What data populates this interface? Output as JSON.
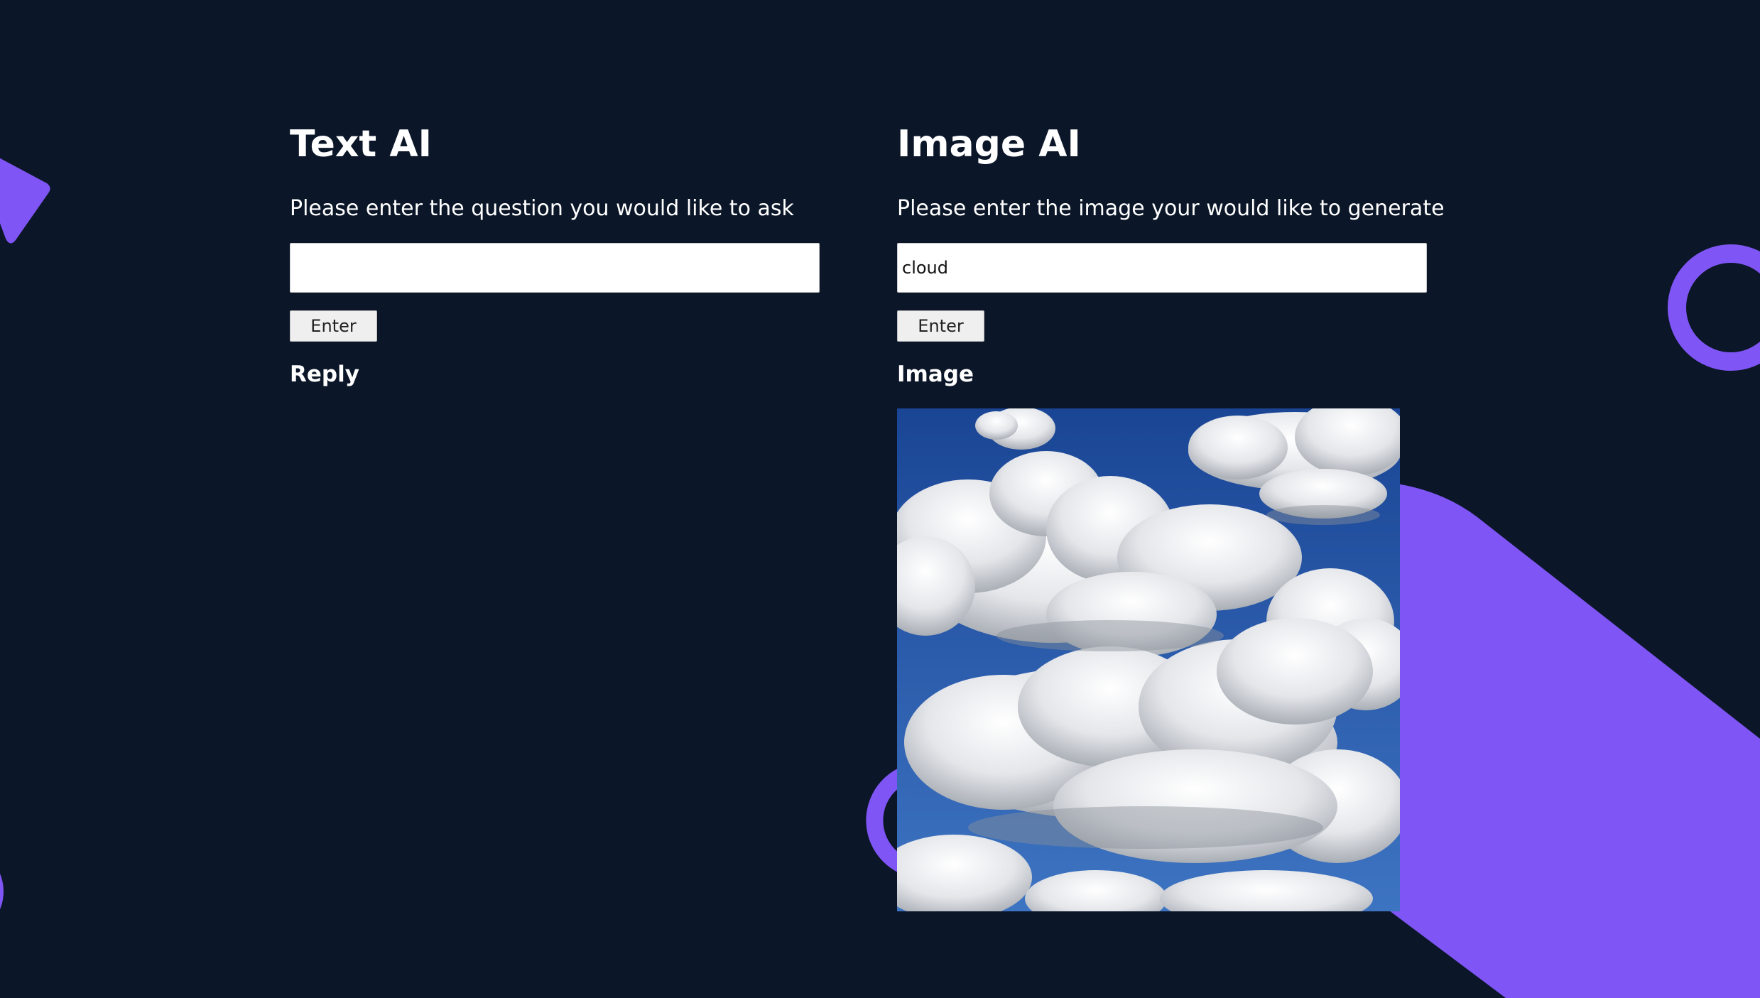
{
  "theme": {
    "background": "#0b1628",
    "accent": "#7f56f5",
    "text": "#ffffff"
  },
  "text_ai": {
    "title": "Text AI",
    "prompt": "Please enter the question you would like to ask",
    "input_value": "",
    "button_label": "Enter",
    "reply_heading": "Reply",
    "reply_text": ""
  },
  "image_ai": {
    "title": "Image AI",
    "prompt": "Please enter the image your would like to generate",
    "input_value": "cloud",
    "button_label": "Enter",
    "image_heading": "Image"
  }
}
